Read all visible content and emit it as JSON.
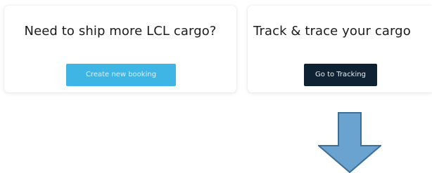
{
  "cards": {
    "ship": {
      "title": "Need to ship more LCL cargo?",
      "button_label": "Create new booking"
    },
    "track": {
      "title": "Track & trace your cargo",
      "button_label": "Go to Tracking"
    }
  },
  "colors": {
    "create_button_bg": "#3fb5e6",
    "tracking_button_bg": "#0e2233",
    "arrow_fill": "#6aa3cf",
    "arrow_stroke": "#3c6e96"
  },
  "annotations": {
    "arrow_direction": "down",
    "arrow_icon": "arrow-down-icon"
  }
}
